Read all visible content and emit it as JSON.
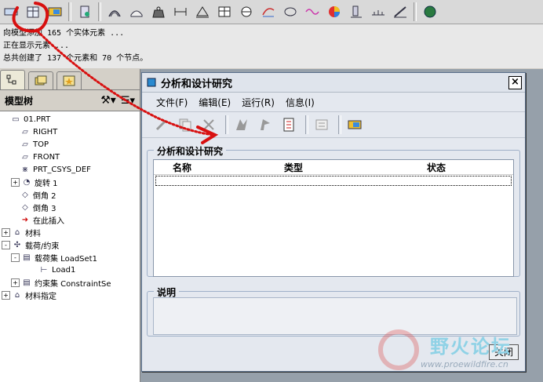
{
  "messages": [
    "向模型添加 165 个实体元素 ...",
    "正在显示元素 ...",
    "总共创建了 137 个元素和 70 个节点。"
  ],
  "tree": {
    "title": "模型树",
    "nodes": [
      {
        "label": "01.PRT",
        "indent": 0,
        "expander": ""
      },
      {
        "label": "RIGHT",
        "indent": 1,
        "expander": ""
      },
      {
        "label": "TOP",
        "indent": 1,
        "expander": ""
      },
      {
        "label": "FRONT",
        "indent": 1,
        "expander": ""
      },
      {
        "label": "PRT_CSYS_DEF",
        "indent": 1,
        "expander": ""
      },
      {
        "label": "旋转 1",
        "indent": 1,
        "expander": "+"
      },
      {
        "label": "倒角 2",
        "indent": 1,
        "expander": ""
      },
      {
        "label": "倒角 3",
        "indent": 1,
        "expander": ""
      },
      {
        "label": "在此插入",
        "indent": 1,
        "expander": ""
      },
      {
        "label": "材料",
        "indent": 0,
        "expander": "+"
      },
      {
        "label": "载荷/约束",
        "indent": 0,
        "expander": "-"
      },
      {
        "label": "载荷集 LoadSet1",
        "indent": 1,
        "expander": "-"
      },
      {
        "label": "Load1",
        "indent": 3,
        "expander": ""
      },
      {
        "label": "约束集 ConstraintSe",
        "indent": 1,
        "expander": "+"
      },
      {
        "label": "材料指定",
        "indent": 0,
        "expander": "+"
      }
    ]
  },
  "dialog": {
    "title": "分析和设计研究",
    "menus": [
      "文件(F)",
      "编辑(E)",
      "运行(R)",
      "信息(I)"
    ],
    "group_label": "分析和设计研究",
    "columns": [
      "名称",
      "类型",
      "状态"
    ],
    "desc_label": "说明",
    "close_label": "关闭"
  },
  "watermark": {
    "title": "野火论坛",
    "url": "www.proewildfire.cn"
  },
  "colors": {
    "annotation": "#d81010",
    "dialog_bg": "#e4e8ef"
  }
}
